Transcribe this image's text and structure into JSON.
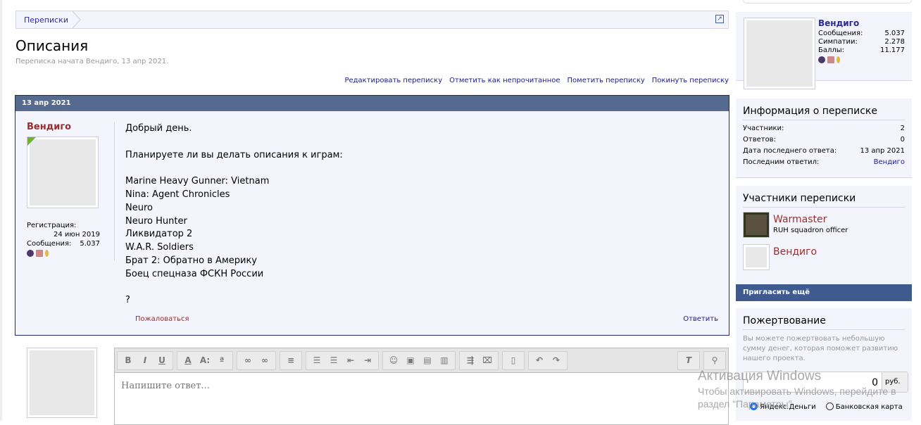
{
  "breadcrumb": {
    "item": "Переписки"
  },
  "title": "Описания",
  "subtitle": "Переписка начата Вендиго, 13 апр 2021.",
  "actions": [
    "Редактировать переписку",
    "Отметить как непрочитанное",
    "Пометить переписку",
    "Покинуть переписку"
  ],
  "message": {
    "date": "13 апр 2021",
    "author": "Вендиго",
    "reg_label": "Регистрация:",
    "reg_value": "24 июн 2019",
    "posts_label": "Сообщения:",
    "posts_value": "5.037",
    "body": "Добрый день.\n\nПланируете ли вы делать описания к играм:\n\nMarine Heavy Gunner: Vietnam\nNina: Agent Chronicles\nNeuro\nNeuro Hunter\nЛиквидатор 2\nW.A.R. Soldiers\nБрат 2: Обратно в Америку\nБоец спецназа ФСКН России\n\n?",
    "report": "Пожаловаться",
    "reply": "Ответить"
  },
  "editor": {
    "placeholder": "Напишите ответ..."
  },
  "profile": {
    "name": "Вендиго",
    "stats": [
      {
        "label": "Сообщения:",
        "value": "5.037"
      },
      {
        "label": "Симпатии:",
        "value": "2.278"
      },
      {
        "label": "Баллы:",
        "value": "11.177"
      }
    ]
  },
  "info": {
    "title": "Информация о переписке",
    "rows": [
      {
        "label": "Участники:",
        "value": "2"
      },
      {
        "label": "Ответов:",
        "value": "0"
      },
      {
        "label": "Дата последнего ответа:",
        "value": "13 апр 2021"
      },
      {
        "label": "Последним ответил:",
        "value": "Вендиго"
      }
    ]
  },
  "participants": {
    "title": "Участники переписки",
    "items": [
      {
        "name": "Warmaster",
        "title": "RUH squadron officer"
      },
      {
        "name": "Вендиго",
        "title": ""
      }
    ],
    "invite": "Пригласить ещё"
  },
  "donate": {
    "title": "Пожертвование",
    "text": "Вы можете пожертвовать небольшую сумму денег, которая поможет развитию нашего проекта.",
    "amount": "0",
    "currency": "руб.",
    "options": [
      "Яндекс.Деньги",
      "Банковская карта"
    ]
  },
  "watermark": {
    "title": "Активация Windows",
    "line1": "Чтобы активировать Windows, перейдите в",
    "line2": "раздел \"Параметры\"."
  }
}
